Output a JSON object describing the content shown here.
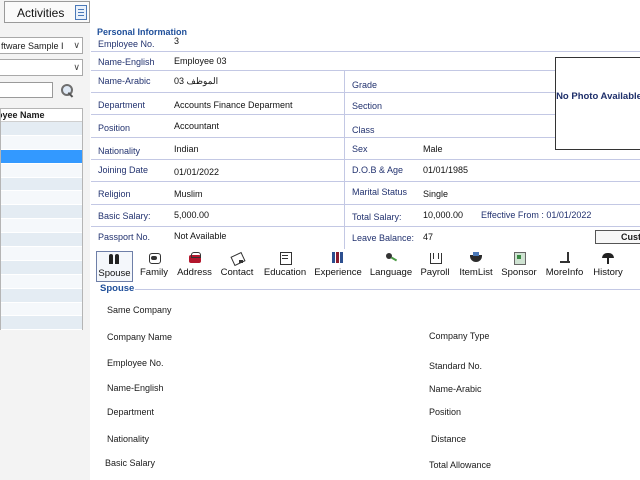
{
  "activities": {
    "label": "Activities",
    "icon": "document-icon"
  },
  "left": {
    "combo1": "ftware Sample I",
    "combo2": "",
    "search_value": "",
    "list_header": "oyee Name",
    "selected_row_color": "#3399ff"
  },
  "personal": {
    "title": "Personal Information",
    "employee_no_label": "Employee No.",
    "employee_no": "3",
    "name_en_label": "Name-English",
    "name_en": "Employee 03",
    "name_ar_label": "Name-Arabic",
    "name_ar": "الموظف 03",
    "grade_label": "Grade",
    "grade": "",
    "department_label": "Department",
    "department": "Accounts  Finance Deparment",
    "section_label": "Section",
    "section": "",
    "position_label": "Position",
    "position": "Accountant",
    "class_label": "Class",
    "class": "",
    "nationality_label": "Nationality",
    "nationality": "Indian",
    "sex_label": "Sex",
    "sex": "Male",
    "joining_label": "Joining Date",
    "joining": "01/01/2022",
    "dob_label": "D.O.B & Age",
    "dob": "01/01/1985",
    "religion_label": "Religion",
    "religion": "Muslim",
    "marital_label": "Marital Status",
    "marital": "Single",
    "basic_salary_label": "Basic Salary:",
    "basic_salary": "5,000.00",
    "total_salary_label": "Total Salary:",
    "total_salary": "10,000.00",
    "effective": "Effective From : 01/01/2022",
    "passport_label": "Passport No.",
    "passport": "Not Available",
    "leave_label": "Leave Balance:",
    "leave": "47",
    "custom_button": "Custo",
    "photo_text": "No Photo Available"
  },
  "toolbar": [
    {
      "label": "Spouse",
      "icon": "spouse-icon"
    },
    {
      "label": "Family",
      "icon": "family-icon"
    },
    {
      "label": "Address",
      "icon": "address-icon"
    },
    {
      "label": "Contact",
      "icon": "contact-icon"
    },
    {
      "label": "Education",
      "icon": "education-icon"
    },
    {
      "label": "Experience",
      "icon": "experience-icon"
    },
    {
      "label": "Language",
      "icon": "language-icon"
    },
    {
      "label": "Payroll",
      "icon": "payroll-icon"
    },
    {
      "label": "ItemList",
      "icon": "itemlist-icon"
    },
    {
      "label": "Sponsor",
      "icon": "sponsor-icon"
    },
    {
      "label": "MoreInfo",
      "icon": "moreinfo-icon"
    },
    {
      "label": "History",
      "icon": "history-icon"
    }
  ],
  "spouse": {
    "title": "Spouse",
    "same_company": "Same Company",
    "company_name": "Company Name",
    "company_type": "Company Type",
    "employee_no": "Employee No.",
    "standard_no": "Standard No.",
    "name_en": "Name-English",
    "name_ar": "Name-Arabic",
    "department": "Department",
    "position": "Position",
    "nationality": "Nationality",
    "distance": "Distance",
    "basic_salary": "Basic Salary",
    "total_allowance": "Total Allowance"
  }
}
